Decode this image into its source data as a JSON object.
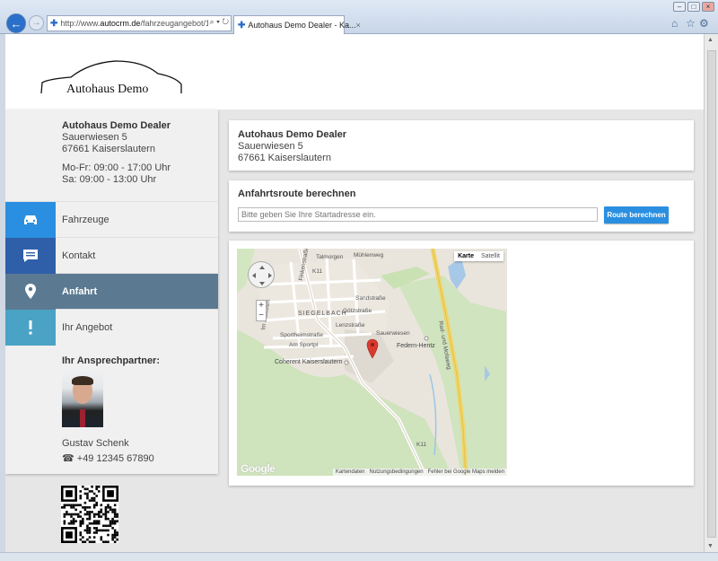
{
  "browser": {
    "url_prefix": "http://www.",
    "url_domain": "autocrm.de",
    "url_path": "/fahrzeugangebot/117",
    "url_controls": "⌕ ▾ ↻",
    "tab_title": "Autohaus Demo Dealer - Ka...",
    "tab_close": "×",
    "fav_glyph": "✚",
    "back_glyph": "←",
    "forward_glyph": "→",
    "window_buttons": [
      "–",
      "□",
      "×"
    ],
    "right_icons": [
      "⌂",
      "☆",
      "⚙"
    ]
  },
  "logo": {
    "text": "Autohaus Demo"
  },
  "dealer": {
    "name": "Autohaus Demo Dealer",
    "street": "Sauerwiesen 5",
    "city": "67661 Kaiserslautern",
    "hours_weekday": "Mo-Fr: 09:00 - 17:00 Uhr",
    "hours_saturday": "Sa: 09:00 - 13:00 Uhr"
  },
  "menu": [
    {
      "label": "Fahrzeuge",
      "color": "#2a8fe0",
      "icon": "car-icon"
    },
    {
      "label": "Kontakt",
      "color": "#2f5fa8",
      "icon": "chat-icon"
    },
    {
      "label": "Anfahrt",
      "color": "#5b7a92",
      "icon": "location-pin-icon"
    },
    {
      "label": "Ihr Angebot",
      "color": "#4aa3c4",
      "icon": "exclamation-icon"
    }
  ],
  "contact": {
    "heading": "Ihr Ansprechpartner:",
    "name": "Gustav Schenk",
    "phone_icon": "☎",
    "phone": "+49 12345 67890"
  },
  "route": {
    "title": "Anfahrtsroute berechnen",
    "placeholder": "Bitte geben Sie Ihre Startadresse ein.",
    "button": "Route berechnen"
  },
  "map": {
    "type_map": "Karte",
    "type_satellite": "Satellit",
    "zoom_in": "+",
    "zoom_out": "−",
    "labels": {
      "siegelbach": "SIEGELBACH",
      "sportheim": "Sportheimstraße",
      "sportler": "Am Sportpl",
      "lenz": "Lenzstraße",
      "goetz": "Götzstraße",
      "sand": "Sandstraße",
      "talmorgen": "Talmorgen",
      "muehl": "Mühlenweg",
      "sauer": "Sauerwiesen",
      "federn": "Federn-Hentz",
      "coherent": "Coherent Kaiserslautern",
      "rad": "Rad- und Mofaweg",
      "k11a": "K11",
      "k11b": "K11",
      "finken": "Finkenstraße",
      "kalkofen": "Im Kalkofen"
    },
    "google": "Google",
    "footer": {
      "data": "Kartendaten",
      "terms": "Nutzungsbedingungen",
      "report": "Fehler bei Google Maps melden"
    }
  },
  "colors": {
    "accent_blue": "#2a8fe0",
    "active_menu": "#5b7a92",
    "pin": "#d93a30"
  }
}
